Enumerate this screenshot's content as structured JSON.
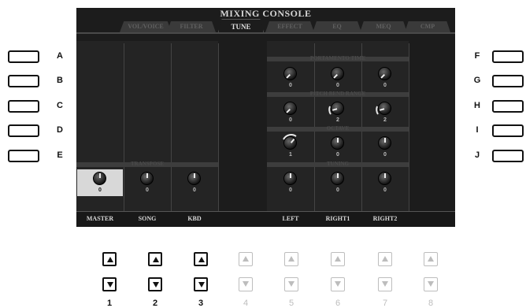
{
  "screen": {
    "title": "MIXING CONSOLE",
    "tabs": [
      "VOL/VOICE",
      "FILTER",
      "TUNE",
      "EFFECT",
      "EQ",
      "MEQ",
      "CMP"
    ],
    "active_tab": "TUNE"
  },
  "sections": {
    "transpose": "TRANSPOSE",
    "portamento_time": "PORTAMENTO TIME",
    "pitch_bend_range": "PITCH BEND RANGE",
    "octave": "OCTAVE",
    "tuning": "TUNING"
  },
  "transpose": {
    "master": "0",
    "song": "0",
    "kbd": "0"
  },
  "portamento_time": {
    "left": "0",
    "right1": "0",
    "right2": "0"
  },
  "pitch_bend_range": {
    "left": "0",
    "right1": "2",
    "right2": "2"
  },
  "octave": {
    "left": "1",
    "right1": "0",
    "right2": "0"
  },
  "tuning": {
    "left": "0",
    "right1": "0",
    "right2": "0"
  },
  "bottom_labels": [
    "MASTER",
    "SONG",
    "KBD",
    "",
    "LEFT",
    "RIGHT1",
    "RIGHT2",
    ""
  ],
  "left_buttons": [
    "A",
    "B",
    "C",
    "D",
    "E"
  ],
  "right_buttons": [
    "F",
    "G",
    "H",
    "I",
    "J"
  ],
  "column_numbers": [
    "1",
    "2",
    "3",
    "4",
    "5",
    "6",
    "7",
    "8"
  ]
}
